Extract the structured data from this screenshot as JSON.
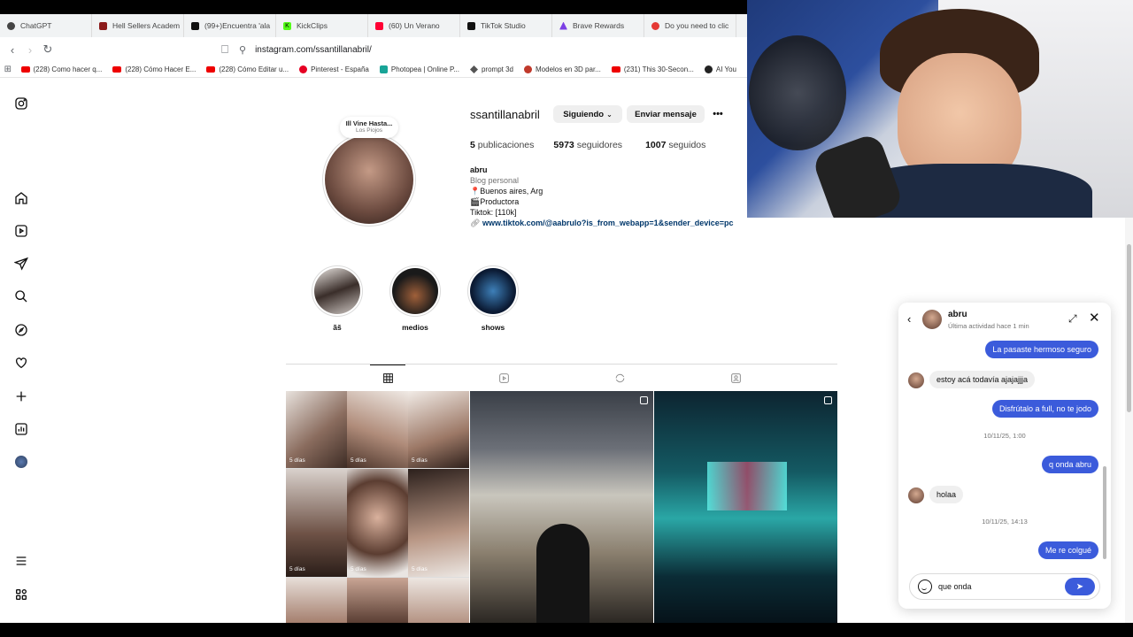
{
  "browser": {
    "tabs": [
      {
        "label": "ChatGPT",
        "color": "#444444"
      },
      {
        "label": "Hell Sellers Academ",
        "color": "#8b1a1a"
      },
      {
        "label": "(99+)Encuentra 'ala",
        "color": "#111111"
      },
      {
        "label": "KickClips",
        "color": "#53fc18"
      },
      {
        "label": "(60) Un Verano",
        "color": "#ff0033"
      },
      {
        "label": "TikTok Studio",
        "color": "#111111"
      },
      {
        "label": "Brave Rewards",
        "color": "#7b3fe4"
      },
      {
        "label": "Do you need to clic",
        "color": "#e53935"
      }
    ],
    "url": "instagram.com/ssantillanabril/",
    "bookmarks": [
      "(228) Como hacer q...",
      "(228) Cómo Hacer E...",
      "(228) Cómo Editar u...",
      "Pinterest - España",
      "Photopea | Online P...",
      "prompt 3d",
      "Modelos en 3D par...",
      "(231) This 30-Secon...",
      "AI You"
    ]
  },
  "profile": {
    "note_line1": "Ill Vine Hasta...",
    "note_line2": "Los Piojos",
    "username": "ssantillanabril",
    "following_button": "Siguiendo",
    "message_button": "Enviar mensaje",
    "more_button": "•••",
    "posts_count": "5",
    "posts_label": "publicaciones",
    "followers_count": "5973",
    "followers_label": "seguidores",
    "following_count": "1007",
    "following_label": "seguidos",
    "bio_name": "abru",
    "bio_category": "Blog personal",
    "bio_line1": "📍Buenos aires, Arg",
    "bio_line2": "🎬Productora",
    "bio_line3": "Tiktok: [110k]",
    "bio_link": "www.tiktok.com/@aabrulo?is_from_webapp=1&sender_device=pc"
  },
  "highlights": [
    {
      "label": "ãš"
    },
    {
      "label": "medios"
    },
    {
      "label": "shows"
    }
  ],
  "posts": {
    "days_label": "5 días"
  },
  "chat": {
    "name": "abru",
    "status": "Última actividad hace 1 min",
    "messages": [
      {
        "text": "La pasaste hermoso seguro",
        "dir": "out"
      },
      {
        "text": "estoy acá todavía ajajajjja",
        "dir": "in"
      },
      {
        "text": "Disfrútalo a full, no te jodo",
        "dir": "out"
      },
      {
        "text": "q onda abru",
        "dir": "out"
      },
      {
        "text": "holaa",
        "dir": "in"
      },
      {
        "text": "Me re  colgué",
        "dir": "out"
      }
    ],
    "stamp1": "10/11/25, 1:00",
    "stamp2": "10/11/25, 14:13",
    "draft": "que onda",
    "accent": "#3b5bdb"
  }
}
